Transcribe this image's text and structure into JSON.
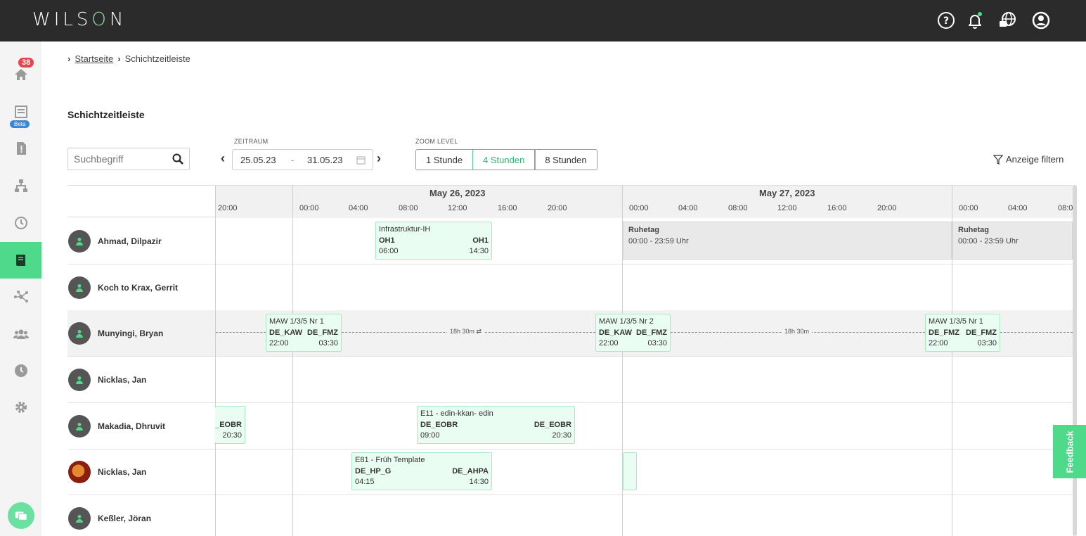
{
  "app": {
    "logo": "WILSON"
  },
  "topbar": {
    "icons": [
      "help-icon",
      "bell-icon",
      "globe-chat-icon",
      "user-icon"
    ]
  },
  "sidebar": {
    "items": [
      "home-icon",
      "schedule-report-icon",
      "document-alert-icon",
      "org-chart-icon",
      "clock-icon",
      "book-icon",
      "network-icon",
      "team-icon",
      "time-icon",
      "gear-icon"
    ],
    "badge_count": "38",
    "badge_beta": "Beta"
  },
  "breadcrumb": {
    "home": "Startseite",
    "current": "Schichtzeitleiste"
  },
  "page": {
    "title": "Schichtzeitleiste"
  },
  "search": {
    "placeholder": "Suchbegriff"
  },
  "period": {
    "label": "ZEITRAUM",
    "from": "25.05.23",
    "sep": "-",
    "to": "31.05.23"
  },
  "zoom": {
    "label": "ZOOM LEVEL",
    "options": [
      "1 Stunde",
      "4 Stunden",
      "8 Stunden"
    ],
    "active": "4 Stunden"
  },
  "filter": {
    "label": "Anzeige filtern"
  },
  "timeline": {
    "days": [
      "May 26, 2023",
      "May 27, 2023"
    ],
    "hours_prev": [
      "20:00"
    ],
    "hours_day": [
      "00:00",
      "04:00",
      "08:00",
      "12:00",
      "16:00",
      "20:00"
    ],
    "hours_next": [
      "00:00",
      "04:00",
      "08:0"
    ]
  },
  "employees": [
    {
      "name": "Ahmad, Dilpazir"
    },
    {
      "name": "Koch to Krax, Gerrit"
    },
    {
      "name": "Munyingi, Bryan"
    },
    {
      "name": "Nicklas, Jan"
    },
    {
      "name": "Makadia, Dhruvit"
    },
    {
      "name": "Nicklas, Jan"
    },
    {
      "name": "Keßler, Jöran"
    }
  ],
  "shifts": {
    "infra": {
      "title": "Infrastruktur-IH",
      "from_loc": "OH1",
      "to_loc": "OH1",
      "start": "06:00",
      "end": "14:30"
    },
    "rest1": {
      "title": "Ruhetag",
      "time": "00:00 - 23:59 Uhr"
    },
    "rest2": {
      "title": "Ruhetag",
      "time": "00:00 - 23:59 Uhr"
    },
    "maw1": {
      "title": "MAW 1/3/5 Nr 1",
      "from_loc": "DE_KAW",
      "to_loc": "DE_FMZ",
      "start": "22:00",
      "end": "03:30"
    },
    "maw2": {
      "title": "MAW 1/3/5 Nr 2",
      "from_loc": "DE_KAW",
      "to_loc": "DE_FMZ",
      "start": "22:00",
      "end": "03:30"
    },
    "maw3": {
      "title": "MAW 1/3/5 Nr 1",
      "from_loc": "DE_FMZ",
      "to_loc": "DE_FMZ",
      "start": "22:00",
      "end": "03:30"
    },
    "gap1": "18h 30m",
    "gap2": "18h 30m",
    "partial": {
      "to_loc": "E_EOBR",
      "end": "20:30"
    },
    "e11": {
      "title": "E11 - edin-kkan- edin",
      "from_loc": "DE_EOBR",
      "to_loc": "DE_EOBR",
      "start": "09:00",
      "end": "20:30"
    },
    "e81": {
      "title": "E81 - Früh Template",
      "from_loc": "DE_HP_G",
      "to_loc": "DE_AHPA",
      "start": "04:15",
      "end": "14:30"
    }
  },
  "feedback": {
    "label": "Feedback"
  },
  "colors": {
    "accent": "#4fd98b",
    "topbar": "#2b2b2b",
    "badge": "#e8434f"
  }
}
